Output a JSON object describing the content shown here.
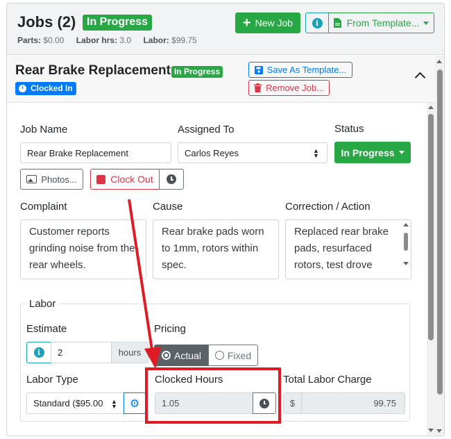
{
  "header": {
    "title": "Jobs (2)",
    "status_badge": "In Progress",
    "parts_label": "Parts:",
    "parts_value": "$0.00",
    "labor_hrs_label": "Labor hrs:",
    "labor_hrs_value": "3.0",
    "labor_label": "Labor:",
    "labor_value": "$99.75",
    "new_job_label": "New Job",
    "info_icon": "info-circle-icon",
    "from_template_label": "From Template..."
  },
  "job": {
    "title": "Rear Brake Replacement",
    "status_badge": "In Progress",
    "clocked_badge": "Clocked In",
    "save_template_label": "Save As Template...",
    "remove_job_label": "Remove Job..."
  },
  "form": {
    "job_name_label": "Job Name",
    "job_name_value": "Rear Brake Replacement",
    "assigned_to_label": "Assigned To",
    "assigned_to_value": "Carlos Reyes",
    "status_label": "Status",
    "status_value": "In Progress",
    "photos_label": "Photos...",
    "clock_out_label": "Clock Out",
    "complaint_label": "Complaint",
    "complaint_text": "Customer reports grinding noise from the rear wheels.",
    "cause_label": "Cause",
    "cause_text": "Rear brake pads worn to 1mm, rotors within spec.",
    "correction_label": "Correction / Action",
    "correction_text": "Replaced rear brake pads, resurfaced rotors, test drove"
  },
  "labor": {
    "legend": "Labor",
    "estimate_label": "Estimate",
    "estimate_value": "2",
    "estimate_unit": "hours",
    "pricing_label": "Pricing",
    "pricing_options": [
      "Actual",
      "Fixed"
    ],
    "pricing_selected": "Actual",
    "labor_type_label": "Labor Type",
    "labor_type_value": "Standard ($95.00",
    "clocked_hours_label": "Clocked Hours",
    "clocked_hours_value": "1.05",
    "total_label": "Total Labor Charge",
    "currency_symbol": "$",
    "total_value": "99.75"
  },
  "colors": {
    "success": "#28a745",
    "primary": "#007bff",
    "danger": "#dc3545",
    "info": "#17a2b8",
    "annotation": "#e01b24"
  }
}
